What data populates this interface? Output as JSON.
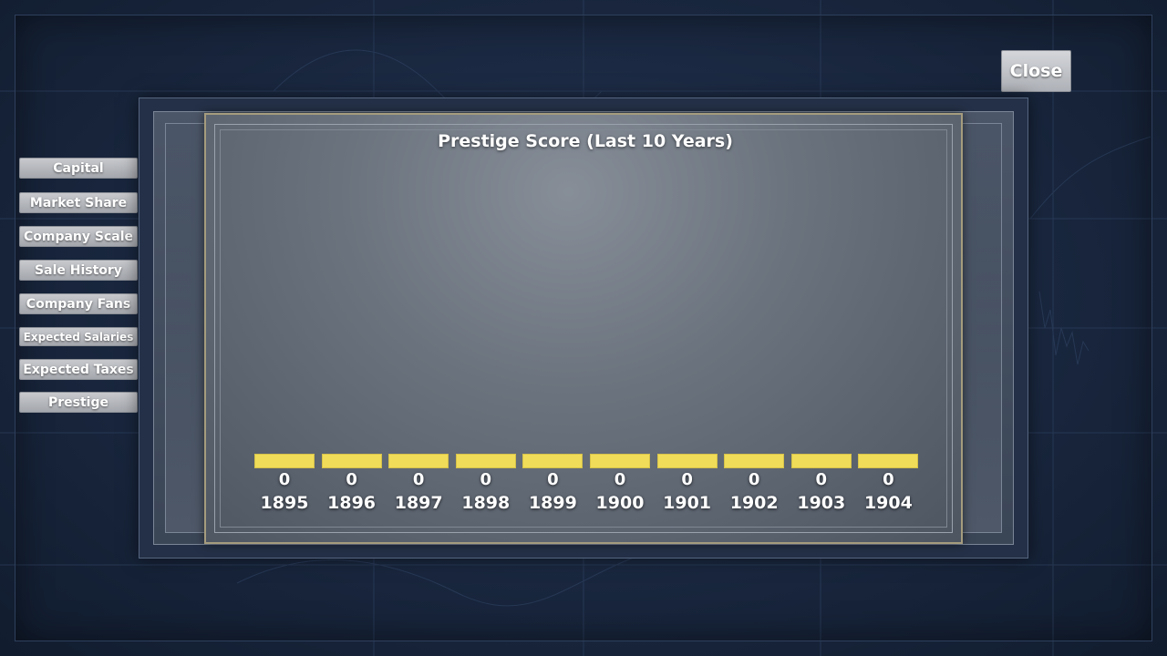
{
  "sidebar": {
    "items": [
      {
        "label": "Capital"
      },
      {
        "label": "Market Share"
      },
      {
        "label": "Company Scale"
      },
      {
        "label": "Sale History"
      },
      {
        "label": "Company Fans"
      },
      {
        "label": "Expected Salaries"
      },
      {
        "label": "Expected Taxes"
      },
      {
        "label": "Prestige"
      }
    ]
  },
  "close_label": "Close",
  "chart_data": {
    "type": "bar",
    "title": "Prestige Score (Last 10 Years)",
    "categories": [
      "1895",
      "1896",
      "1897",
      "1898",
      "1899",
      "1900",
      "1901",
      "1902",
      "1903",
      "1904"
    ],
    "values": [
      0,
      0,
      0,
      0,
      0,
      0,
      0,
      0,
      0,
      0
    ],
    "value_labels": [
      "0",
      "0",
      "0",
      "0",
      "0",
      "0",
      "0",
      "0",
      "0",
      "0"
    ],
    "bar_color": "#f0dc58",
    "grid": false
  }
}
